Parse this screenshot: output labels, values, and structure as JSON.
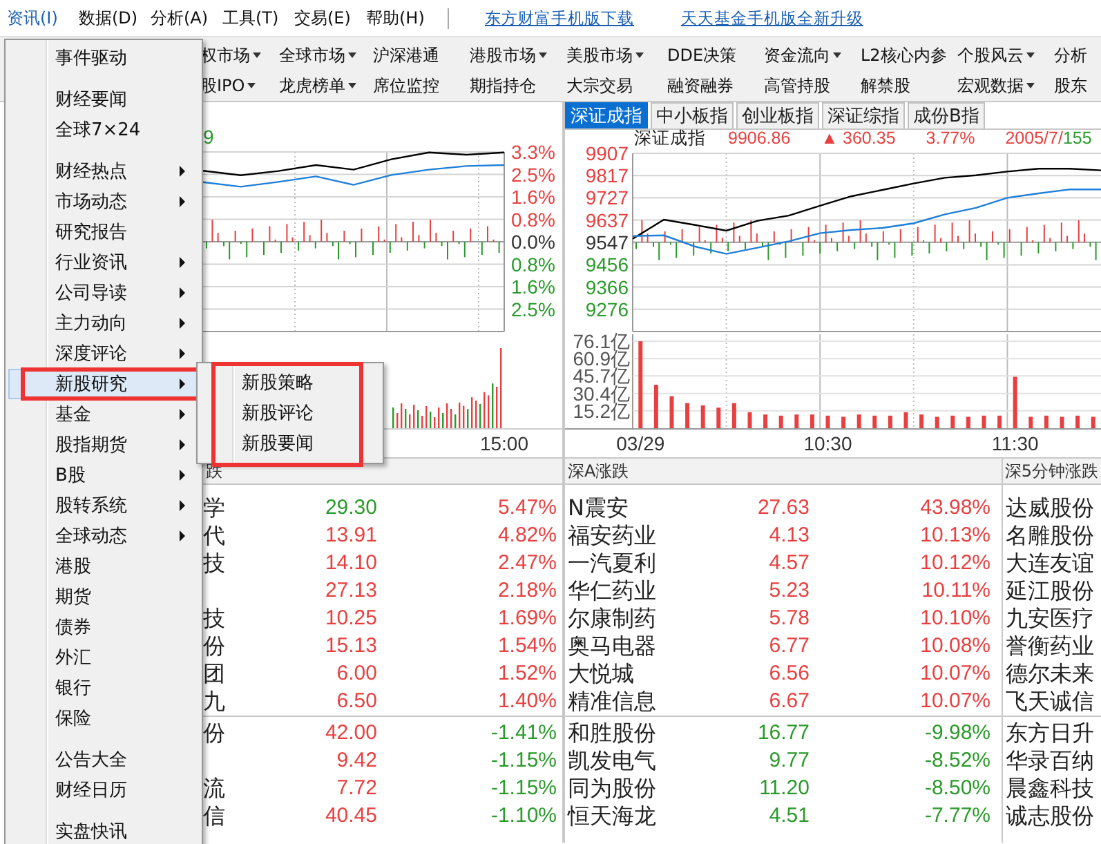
{
  "menubar": {
    "items": [
      {
        "label": "资讯(I)",
        "selected": true
      },
      {
        "label": "数据(D)",
        "selected": false
      },
      {
        "label": "分析(A)",
        "selected": false
      },
      {
        "label": "工具(T)",
        "selected": false
      },
      {
        "label": "交易(E)",
        "selected": false
      },
      {
        "label": "帮助(H)",
        "selected": false
      }
    ],
    "links": [
      "东方财富手机版下载",
      "天天基金手机版全新升级"
    ]
  },
  "nav": {
    "rows": [
      [
        {
          "label": "权市场",
          "dropdown": true
        },
        {
          "label": "全球市场",
          "dropdown": true
        },
        {
          "label": "沪深港通",
          "dropdown": false
        },
        {
          "label": "港股市场",
          "dropdown": true
        },
        {
          "label": "美股市场",
          "dropdown": true
        },
        {
          "label": "DDE决策",
          "dropdown": false
        },
        {
          "label": "资金流向",
          "dropdown": true
        },
        {
          "label": "L2核心内参",
          "dropdown": false
        },
        {
          "label": "个股风云",
          "dropdown": true
        },
        {
          "label": "分析",
          "dropdown": false
        }
      ],
      [
        {
          "label": "股IPO",
          "dropdown": true
        },
        {
          "label": "龙虎榜单",
          "dropdown": true
        },
        {
          "label": "席位监控",
          "dropdown": false
        },
        {
          "label": "期指持仓",
          "dropdown": false
        },
        {
          "label": "大宗交易",
          "dropdown": false
        },
        {
          "label": "融资融券",
          "dropdown": false
        },
        {
          "label": "高管持股",
          "dropdown": false
        },
        {
          "label": "解禁股",
          "dropdown": false
        },
        {
          "label": "宏观数据",
          "dropdown": true
        },
        {
          "label": "股东",
          "dropdown": false
        }
      ]
    ]
  },
  "left_panel": {
    "top_label": "9",
    "chart_data": {
      "type": "line",
      "ylim": [
        -3.3,
        3.3
      ],
      "categories": [
        null,
        null,
        null,
        null,
        null,
        null,
        null,
        null,
        null
      ],
      "yticks": [
        {
          "value": 3.3,
          "label": "3.3%"
        },
        {
          "value": 2.475,
          "label": "2.5%"
        },
        {
          "value": 1.65,
          "label": "1.6%"
        },
        {
          "value": 0.825,
          "label": "0.8%"
        },
        {
          "value": 0,
          "label": "0.0%"
        },
        {
          "value": -0.825,
          "label": "0.8%"
        },
        {
          "value": -1.65,
          "label": "1.6%"
        },
        {
          "value": -2.475,
          "label": "2.5%"
        }
      ],
      "series": [
        {
          "color": "#000000",
          "values": [
            2.61,
            2.44,
            2.6,
            2.82,
            2.65,
            3.03,
            3.28,
            3.2,
            3.28
          ]
        },
        {
          "color": "#1e7fd8",
          "values": [
            2.19,
            2.02,
            2.2,
            2.4,
            2.09,
            2.45,
            2.65,
            2.78,
            2.82
          ]
        }
      ]
    },
    "time_label": "15:00"
  },
  "right_panel": {
    "tabs": [
      {
        "label": "深证成指",
        "selected": true
      },
      {
        "label": "中小板指",
        "selected": false
      },
      {
        "label": "创业板指",
        "selected": false
      },
      {
        "label": "深证综指",
        "selected": false
      },
      {
        "label": "成份B指",
        "selected": false
      }
    ],
    "info": {
      "name": "深证成指",
      "value": "9906.86",
      "arrow": "▲",
      "change": "360.35",
      "percent": "3.77%",
      "up": true,
      "counts": [
        {
          "text": "2005/7/",
          "up": true
        },
        {
          "text": "155",
          "up": false
        }
      ]
    },
    "chart_data": {
      "type": "line",
      "ylim": [
        9186,
        9907
      ],
      "categories": [
        null,
        null,
        null,
        null,
        null,
        null,
        null,
        null,
        null,
        null,
        null,
        null,
        null,
        null,
        null,
        null
      ],
      "yticks": [
        9907,
        9817,
        9727,
        9637,
        9547,
        9456,
        9366,
        9276
      ],
      "series": [
        {
          "color": "#000000",
          "values": [
            9561,
            9639,
            9617,
            9594,
            9634,
            9655,
            9695,
            9733,
            9759,
            9785,
            9808,
            9818,
            9833,
            9845,
            9845,
            9838
          ]
        },
        {
          "color": "#1e7fd8",
          "values": [
            9572,
            9575,
            9530,
            9500,
            9525,
            9551,
            9584,
            9597,
            9605,
            9624,
            9660,
            9687,
            9727,
            9745,
            9761,
            9761
          ]
        }
      ]
    },
    "volume": {
      "chart_data": {
        "type": "bar",
        "ylim": [
          0,
          76.1
        ],
        "categories": [
          "03/29",
          null,
          null,
          null,
          null,
          null,
          null,
          null,
          null,
          null,
          null,
          null,
          "10:30",
          null,
          null,
          null,
          null,
          null,
          null,
          null,
          null,
          null,
          null,
          null,
          "11:30",
          null,
          null,
          null,
          null,
          null
        ],
        "yticks": [
          {
            "value": 76.1,
            "label": "76.1亿"
          },
          {
            "value": 60.9,
            "label": "60.9亿"
          },
          {
            "value": 45.7,
            "label": "45.7亿"
          },
          {
            "value": 30.4,
            "label": "30.4亿"
          },
          {
            "value": 15.2,
            "label": "15.2亿"
          }
        ],
        "series": [
          {
            "color": "#e84040",
            "values": [
              76,
              38,
              28,
              22,
              20,
              18,
              22,
              14,
              12,
              11,
              12,
              12,
              11,
              10,
              12,
              11,
              11,
              14,
              12,
              10,
              11,
              10,
              11,
              11,
              45,
              10,
              11,
              10,
              11,
              10
            ]
          }
        ]
      }
    }
  },
  "left_table": {
    "header": "跌",
    "groups": [
      [
        {
          "name": "学",
          "price": "29.30",
          "price_up": false,
          "change": "5.47%",
          "change_up": true
        },
        {
          "name": "代",
          "price": "13.91",
          "price_up": true,
          "change": "4.82%",
          "change_up": true
        },
        {
          "name": "技",
          "price": "14.10",
          "price_up": true,
          "change": "2.47%",
          "change_up": true
        },
        {
          "price": "27.13",
          "price_up": true,
          "change": "2.18%",
          "change_up": true
        },
        {
          "name": "技",
          "price": "10.25",
          "price_up": true,
          "change": "1.69%",
          "change_up": true
        },
        {
          "name": "份",
          "price": "15.13",
          "price_up": true,
          "change": "1.54%",
          "change_up": true
        },
        {
          "name": "团",
          "price": "6.00",
          "price_up": true,
          "change": "1.52%",
          "change_up": true
        },
        {
          "name": "九",
          "price": "6.50",
          "price_up": true,
          "change": "1.40%",
          "change_up": true
        }
      ],
      [
        {
          "name": "份",
          "price": "42.00",
          "price_up": true,
          "change": "-1.41%",
          "change_up": false
        },
        {
          "price": "9.42",
          "price_up": true,
          "change": "-1.15%",
          "change_up": false
        },
        {
          "name": "流",
          "price": "7.72",
          "price_up": true,
          "change": "-1.15%",
          "change_up": false
        },
        {
          "name": "信",
          "price": "40.45",
          "price_up": true,
          "change": "-1.10%",
          "change_up": false
        }
      ]
    ]
  },
  "right_table": {
    "header": "深A涨跌",
    "groups": [
      [
        {
          "name": "N震安",
          "price": "27.63",
          "price_up": true,
          "change": "43.98%",
          "change_up": true
        },
        {
          "name": "福安药业",
          "price": "4.13",
          "price_up": true,
          "change": "10.13%",
          "change_up": true
        },
        {
          "name": "一汽夏利",
          "price": "4.57",
          "price_up": true,
          "change": "10.12%",
          "change_up": true
        },
        {
          "name": "华仁药业",
          "price": "5.23",
          "price_up": true,
          "change": "10.11%",
          "change_up": true
        },
        {
          "name": "尔康制药",
          "price": "5.78",
          "price_up": true,
          "change": "10.10%",
          "change_up": true
        },
        {
          "name": "奥马电器",
          "price": "6.77",
          "price_up": true,
          "change": "10.08%",
          "change_up": true
        },
        {
          "name": "大悦城",
          "price": "6.56",
          "price_up": true,
          "change": "10.07%",
          "change_up": true
        },
        {
          "name": "精准信息",
          "price": "6.67",
          "price_up": true,
          "change": "10.07%",
          "change_up": true
        }
      ],
      [
        {
          "name": "和胜股份",
          "price": "16.77",
          "price_up": false,
          "change": "-9.98%",
          "change_up": false
        },
        {
          "name": "凯发电气",
          "price": "9.77",
          "price_up": false,
          "change": "-8.52%",
          "change_up": false
        },
        {
          "name": "同为股份",
          "price": "11.20",
          "price_up": false,
          "change": "-8.50%",
          "change_up": false
        },
        {
          "name": "恒天海龙",
          "price": "4.51",
          "price_up": false,
          "change": "-7.77%",
          "change_up": false
        }
      ]
    ]
  },
  "five_min": {
    "header": "深5分钟涨跌",
    "groups": [
      [
        "达威股份",
        "名雕股份",
        "大连友谊",
        "延江股份",
        "九安医疗",
        "誉衡药业",
        "德尔未来",
        "飞天诚信"
      ],
      [
        "东方日升",
        "华录百纳",
        "晨鑫科技",
        "诚志股份"
      ]
    ]
  },
  "menu": {
    "items": [
      {
        "kind": "item",
        "label": "事件驱动",
        "submenu": false,
        "selected": false
      },
      {
        "kind": "separator"
      },
      {
        "kind": "item",
        "label": "财经要闻",
        "submenu": false,
        "selected": false
      },
      {
        "kind": "item",
        "label": "全球7×24",
        "submenu": false,
        "selected": false
      },
      {
        "kind": "separator"
      },
      {
        "kind": "item",
        "label": "财经热点",
        "submenu": true,
        "selected": false
      },
      {
        "kind": "item",
        "label": "市场动态",
        "submenu": true,
        "selected": false
      },
      {
        "kind": "item",
        "label": "研究报告",
        "submenu": false,
        "selected": false
      },
      {
        "kind": "item",
        "label": "行业资讯",
        "submenu": true,
        "selected": false
      },
      {
        "kind": "item",
        "label": "公司导读",
        "submenu": true,
        "selected": false
      },
      {
        "kind": "item",
        "label": "主力动向",
        "submenu": true,
        "selected": false
      },
      {
        "kind": "item",
        "label": "深度评论",
        "submenu": true,
        "selected": false
      },
      {
        "kind": "item",
        "label": "新股研究",
        "submenu": true,
        "selected": true,
        "marked": true
      },
      {
        "kind": "item",
        "label": "基金",
        "submenu": true,
        "selected": false
      },
      {
        "kind": "item",
        "label": "股指期货",
        "submenu": true,
        "selected": false
      },
      {
        "kind": "item",
        "label": "B股",
        "submenu": true,
        "selected": false
      },
      {
        "kind": "item",
        "label": "股转系统",
        "submenu": true,
        "selected": false
      },
      {
        "kind": "item",
        "label": "全球动态",
        "submenu": true,
        "selected": false
      },
      {
        "kind": "item",
        "label": "港股",
        "submenu": false,
        "selected": false
      },
      {
        "kind": "item",
        "label": "期货",
        "submenu": false,
        "selected": false
      },
      {
        "kind": "item",
        "label": "债券",
        "submenu": false,
        "selected": false
      },
      {
        "kind": "item",
        "label": "外汇",
        "submenu": false,
        "selected": false
      },
      {
        "kind": "item",
        "label": "银行",
        "submenu": false,
        "selected": false
      },
      {
        "kind": "item",
        "label": "保险",
        "submenu": false,
        "selected": false
      },
      {
        "kind": "separator"
      },
      {
        "kind": "item",
        "label": "公告大全",
        "submenu": false,
        "selected": false
      },
      {
        "kind": "item",
        "label": "财经日历",
        "submenu": false,
        "selected": false
      },
      {
        "kind": "separator"
      },
      {
        "kind": "item",
        "label": "实盘快讯",
        "submenu": false,
        "selected": false
      }
    ],
    "submenu": {
      "marked": true,
      "items": [
        "新股策略",
        "新股评论",
        "新股要闻"
      ]
    }
  }
}
